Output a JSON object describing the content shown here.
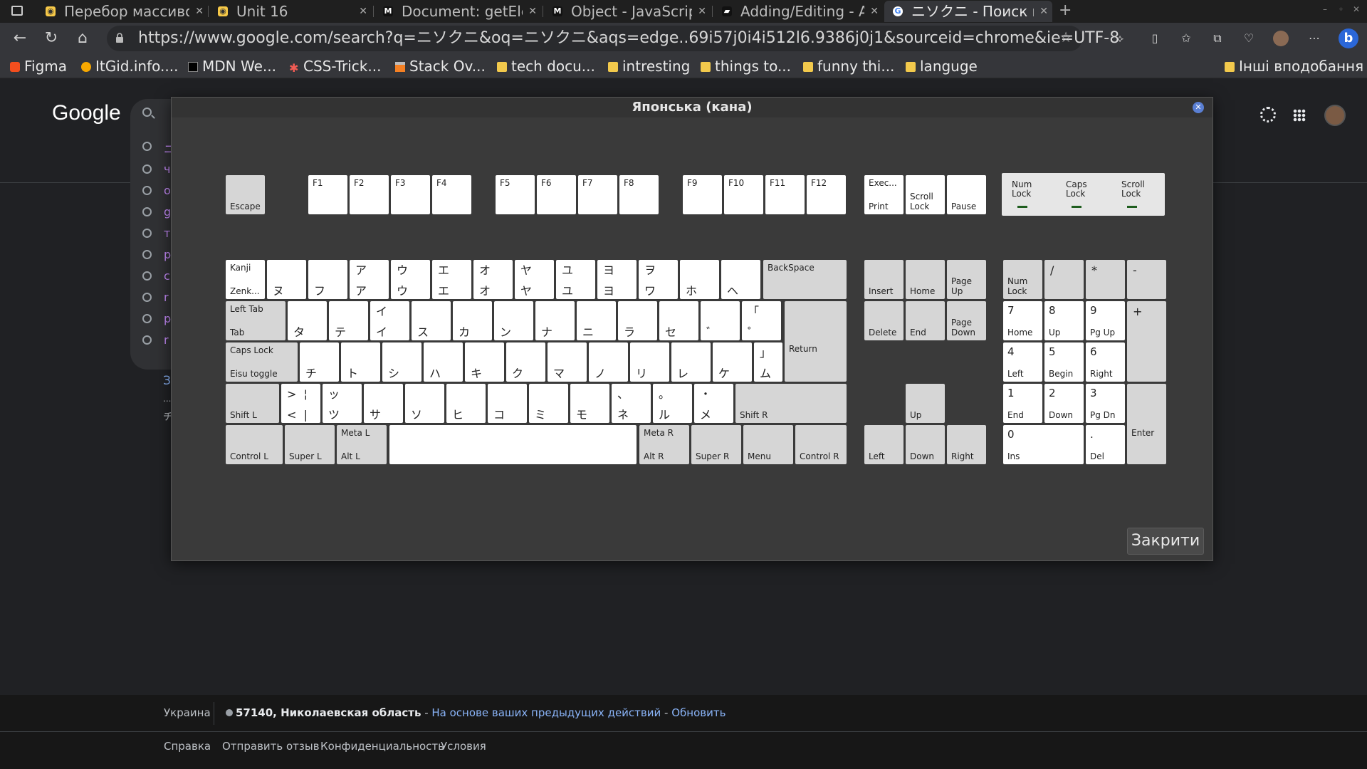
{
  "browser": {
    "tabs": [
      {
        "title": "Перебор массивов",
        "icon": "js-icon",
        "active": false
      },
      {
        "title": "Unit 16",
        "icon": "js-icon",
        "active": false
      },
      {
        "title": "Document: getElementById",
        "icon": "mdn-icon",
        "active": false
      },
      {
        "title": "Object - JavaScript",
        "icon": "mdn-icon",
        "active": false
      },
      {
        "title": "Adding/Editing - A",
        "icon": "book-icon",
        "active": false
      },
      {
        "title": "ニソクニ - Поиск в Google",
        "icon": "google-icon",
        "active": true
      }
    ],
    "url": "https://www.google.com/search?q=ニソクニ&oq=ニソクニ&aqs=edge..69i57j0i4i512l6.9386j0j1&sourceid=chrome&ie=UTF-8",
    "bookmarks": [
      {
        "label": "Figma",
        "icon": "figma-icon"
      },
      {
        "label": "ItGid.info....",
        "icon": "itgid-icon"
      },
      {
        "label": "MDN We...",
        "icon": "mdn-icon"
      },
      {
        "label": "CSS-Trick...",
        "icon": "csstricks-icon"
      },
      {
        "label": "Stack Ov...",
        "icon": "stackoverflow-icon"
      },
      {
        "label": "tech docu...",
        "icon": "folder-icon"
      },
      {
        "label": "intresting",
        "icon": "folder-icon"
      },
      {
        "label": "things to...",
        "icon": "folder-icon"
      },
      {
        "label": "funny thi...",
        "icon": "folder-icon"
      },
      {
        "label": "languge",
        "icon": "folder-icon"
      },
      {
        "label": "Інші вподобання",
        "icon": "folder-icon"
      }
    ]
  },
  "google": {
    "logo": "Google",
    "history_letters": [
      "ニ",
      "ч",
      "о",
      "g",
      "т",
      "р",
      "с",
      "r",
      "р",
      "r"
    ],
    "side_texts": [
      "З",
      "...",
      "チ"
    ]
  },
  "footer": {
    "country": "Украина",
    "location": "57140, Николаевская область",
    "sep": " - ",
    "based_on": "На основе ваших предыдущих действий",
    "update": "Обновить",
    "links": [
      "Справка",
      "Отправить отзыв",
      "Конфиденциальность",
      "Условия"
    ]
  },
  "keyboard": {
    "title": "Японська (кана)",
    "close_label": "Закрити",
    "function_row": {
      "escape": "Escape",
      "f_keys": [
        "F1",
        "F2",
        "F3",
        "F4",
        "F5",
        "F6",
        "F7",
        "F8",
        "F9",
        "F10",
        "F11",
        "F12"
      ],
      "exec_print": [
        "Exec...",
        "Print"
      ],
      "scroll_lock": "Scroll\nLock",
      "pause": "Pause"
    },
    "leds": [
      "Num\nLock",
      "Caps\nLock",
      "Scroll\nLock"
    ],
    "row1": [
      [
        "Kanji",
        "Zenk..."
      ],
      [
        "",
        "ヌ"
      ],
      [
        "",
        "フ"
      ],
      [
        "ア",
        "ア"
      ],
      [
        "ウ",
        "ウ"
      ],
      [
        "エ",
        "エ"
      ],
      [
        "オ",
        "オ"
      ],
      [
        "ヤ",
        "ヤ"
      ],
      [
        "ユ",
        "ユ"
      ],
      [
        "ヨ",
        "ヨ"
      ],
      [
        "ヲ",
        "ワ"
      ],
      [
        "",
        "ホ"
      ],
      [
        "",
        "ヘ"
      ],
      [
        "BackSpace",
        ""
      ]
    ],
    "row2": [
      [
        "Left Tab",
        "Tab"
      ],
      [
        "",
        "タ"
      ],
      [
        "",
        "テ"
      ],
      [
        "イ",
        "イ"
      ],
      [
        "",
        "ス"
      ],
      [
        "",
        "カ"
      ],
      [
        "",
        "ン"
      ],
      [
        "",
        "ナ"
      ],
      [
        "",
        "ニ"
      ],
      [
        "",
        "ラ"
      ],
      [
        "",
        "セ"
      ],
      [
        "",
        "゛"
      ],
      [
        "「",
        "゜"
      ]
    ],
    "return_label": "Return",
    "row3": [
      [
        "Caps Lock",
        "Eisu toggle"
      ],
      [
        "",
        "チ"
      ],
      [
        "",
        "ト"
      ],
      [
        "",
        "シ"
      ],
      [
        "",
        "ハ"
      ],
      [
        "",
        "キ"
      ],
      [
        "",
        "ク"
      ],
      [
        "",
        "マ"
      ],
      [
        "",
        "ノ"
      ],
      [
        "",
        "リ"
      ],
      [
        "",
        "レ"
      ],
      [
        "",
        "ケ"
      ],
      [
        "」",
        "ム"
      ]
    ],
    "row4": [
      [
        "",
        "Shift L"
      ],
      [
        ">  ¦",
        "<  |"
      ],
      [
        "ッ",
        "ツ"
      ],
      [
        "",
        "サ"
      ],
      [
        "",
        "ソ"
      ],
      [
        "",
        "ヒ"
      ],
      [
        "",
        "コ"
      ],
      [
        "",
        "ミ"
      ],
      [
        "",
        "モ"
      ],
      [
        "、",
        "ネ"
      ],
      [
        "。",
        "ル"
      ],
      [
        "・",
        "メ"
      ],
      [
        "",
        "Shift R"
      ]
    ],
    "row5": [
      [
        "",
        "Control L"
      ],
      [
        "",
        "Super L"
      ],
      [
        "Meta L",
        "Alt L"
      ],
      [
        "",
        ""
      ],
      [
        "Meta R",
        "Alt R"
      ],
      [
        "",
        "Super R"
      ],
      [
        "",
        "Menu"
      ],
      [
        "",
        "Control R"
      ]
    ],
    "nav_cluster": {
      "insert": "Insert",
      "home": "Home",
      "page_up": "Page\nUp",
      "delete": "Delete",
      "end": "End",
      "page_down": "Page\nDown",
      "up": "Up",
      "left": "Left",
      "down": "Down",
      "right": "Right"
    },
    "numpad": {
      "numlock": "Num\nLock",
      "divide": "/",
      "multiply": "*",
      "minus": "-",
      "k7": [
        "7",
        "Home"
      ],
      "k8": [
        "8",
        "Up"
      ],
      "k9": [
        "9",
        "Pg Up"
      ],
      "plus": "+",
      "k4": [
        "4",
        "Left"
      ],
      "k5": [
        "5",
        "Begin"
      ],
      "k6": [
        "6",
        "Right"
      ],
      "k1": [
        "1",
        "End"
      ],
      "k2": [
        "2",
        "Down"
      ],
      "k3": [
        "3",
        "Pg Dn"
      ],
      "enter": "Enter",
      "k0": [
        "0",
        "Ins"
      ],
      "dot": [
        ".",
        "Del"
      ]
    }
  }
}
